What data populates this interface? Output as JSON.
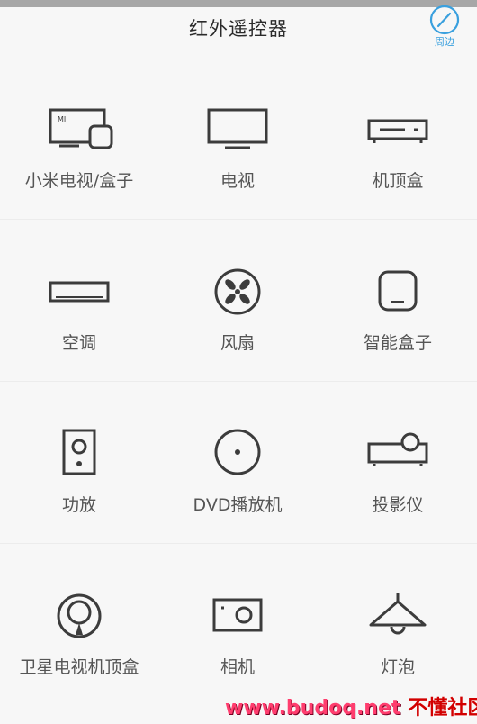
{
  "header": {
    "title": "红外遥控器",
    "nearby_label": "周边",
    "accent_color": "#3aa0de"
  },
  "devices": [
    {
      "label": "小米电视/盒子",
      "icon": "mi-tv-box-icon"
    },
    {
      "label": "电视",
      "icon": "tv-icon"
    },
    {
      "label": "机顶盒",
      "icon": "set-top-box-icon"
    },
    {
      "label": "空调",
      "icon": "air-conditioner-icon"
    },
    {
      "label": "风扇",
      "icon": "fan-icon"
    },
    {
      "label": "智能盒子",
      "icon": "smart-box-icon"
    },
    {
      "label": "功放",
      "icon": "amplifier-icon"
    },
    {
      "label": "DVD播放机",
      "icon": "dvd-player-icon"
    },
    {
      "label": "投影仪",
      "icon": "projector-icon"
    },
    {
      "label": "卫星电视机顶盒",
      "icon": "satellite-tv-box-icon"
    },
    {
      "label": "相机",
      "icon": "camera-icon"
    },
    {
      "label": "灯泡",
      "icon": "light-bulb-icon"
    }
  ],
  "tv_logo_text": "MI",
  "watermark": {
    "url": "www.budoq.net",
    "name": "不懂社区"
  }
}
